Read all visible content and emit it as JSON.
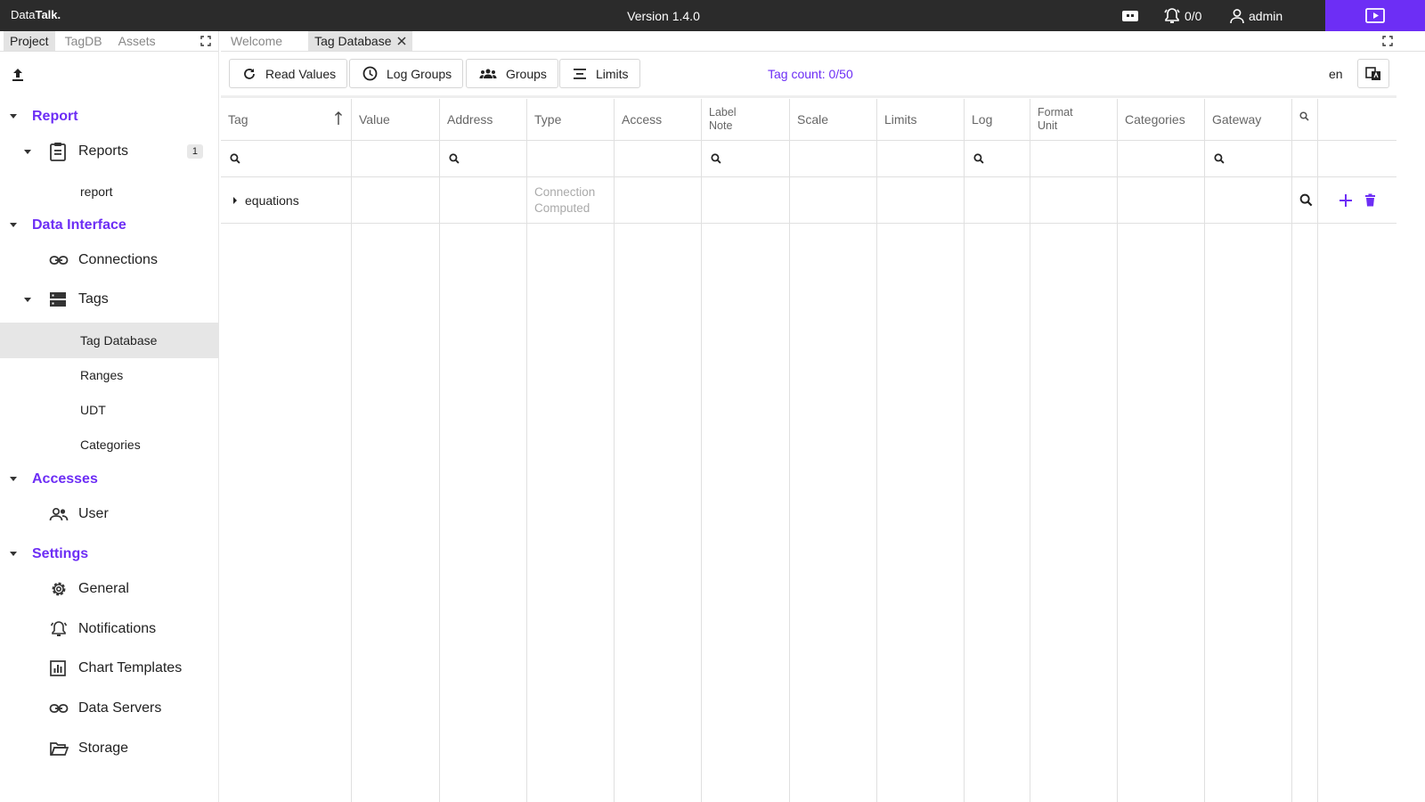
{
  "app": {
    "logo_prefix": "Data",
    "logo_bold": "Talk.",
    "version": "Version 1.4.0",
    "alarms": "0/0",
    "user": "admin"
  },
  "left_tabs": [
    "Project",
    "TagDB",
    "Assets"
  ],
  "tree": {
    "report": {
      "title": "Report",
      "reports_label": "Reports",
      "reports_count": "1",
      "report_leaf": "report"
    },
    "data_interface": {
      "title": "Data Interface",
      "connections": "Connections",
      "tags": "Tags",
      "tag_database": "Tag Database",
      "ranges": "Ranges",
      "udt": "UDT",
      "categories": "Categories"
    },
    "accesses": {
      "title": "Accesses",
      "user": "User"
    },
    "settings": {
      "title": "Settings",
      "general": "General",
      "notifications": "Notifications",
      "chart_templates": "Chart Templates",
      "data_servers": "Data Servers",
      "storage": "Storage"
    }
  },
  "editor_tabs": {
    "welcome": "Welcome",
    "tag_database": "Tag Database"
  },
  "toolbar": {
    "read_values": "Read Values",
    "log_groups": "Log Groups",
    "groups": "Groups",
    "limits": "Limits",
    "tag_count": "Tag count: 0/50",
    "language": "en"
  },
  "table": {
    "headers": {
      "tag": "Tag",
      "value": "Value",
      "address": "Address",
      "type": "Type",
      "access": "Access",
      "label": "Label",
      "note": "Note",
      "scale": "Scale",
      "limits": "Limits",
      "log": "Log",
      "format": "Format",
      "unit": "Unit",
      "categories": "Categories",
      "gateway": "Gateway"
    },
    "rows": [
      {
        "tag": "equations",
        "type_line1": "Connection",
        "type_line2": "Computed"
      }
    ]
  },
  "colors": {
    "accent": "#6d2ef5",
    "topbar": "#2b2b2b",
    "selected": "#e6e6e6"
  }
}
